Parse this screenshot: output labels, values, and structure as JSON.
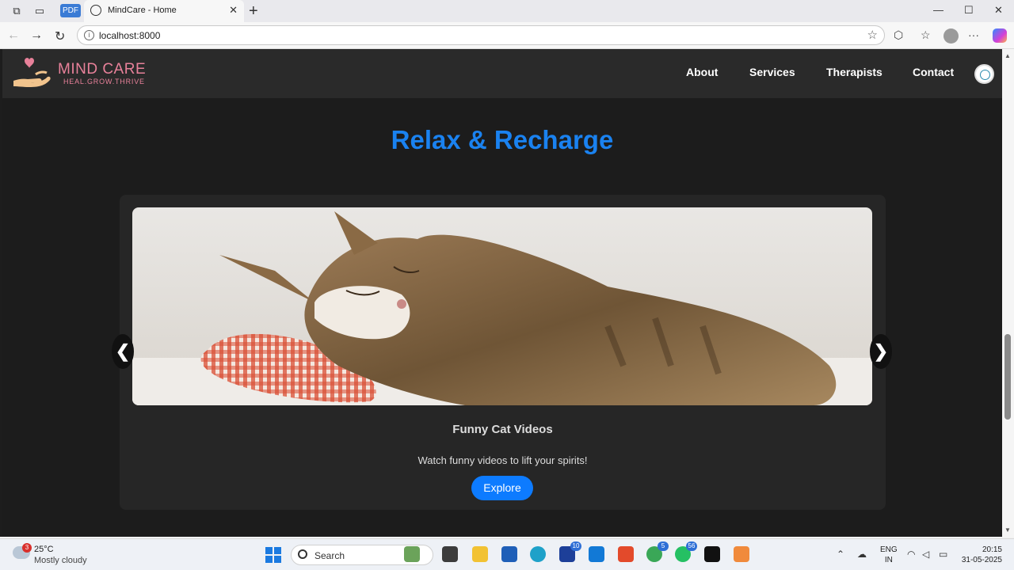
{
  "browser": {
    "tab_title": "MindCare - Home",
    "pdf_badge": "PDF",
    "url": "localhost:8000"
  },
  "site": {
    "logo_name": "MIND CARE",
    "logo_tagline": "HEAL.GROW.THRIVE",
    "nav": [
      "About",
      "Services",
      "Therapists",
      "Contact"
    ]
  },
  "section": {
    "title": "Relax & Recharge"
  },
  "carousel": {
    "slide_title": "Funny Cat Videos",
    "slide_description": "Watch funny videos to lift your spirits!",
    "button_label": "Explore",
    "prev_arrow": "❮",
    "next_arrow": "❯"
  },
  "taskbar": {
    "weather_badge": "3",
    "weather_temp": "25°C",
    "weather_desc": "Mostly cloudy",
    "search_placeholder": "Search",
    "badges": {
      "linkedin": "10",
      "chrome": "5",
      "whatsapp": "56"
    },
    "lang_top": "ENG",
    "lang_bottom": "IN",
    "time": "20:15",
    "date": "31-05-2025"
  },
  "colors": {
    "accent_blue": "#1a82f0",
    "button_blue": "#0d7bff",
    "logo_pink": "#e8819a",
    "header_bg": "#2a2a2a",
    "page_bg": "#1c1c1c"
  }
}
